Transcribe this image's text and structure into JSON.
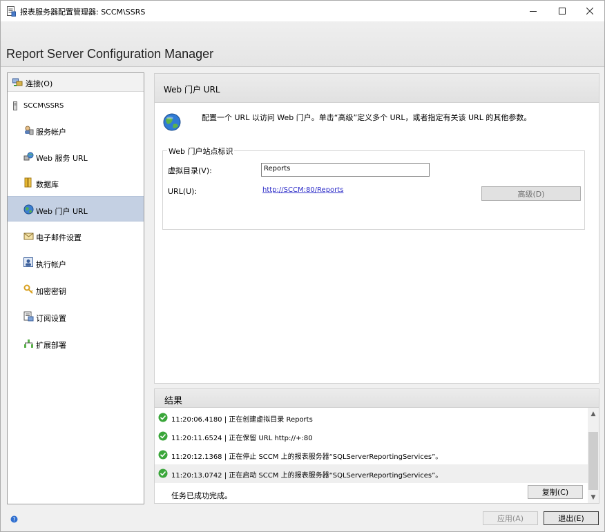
{
  "window": {
    "title": "报表服务器配置管理器: SCCM\\SSRS"
  },
  "banner": {
    "heading": "Report Server Configuration Manager"
  },
  "nav": {
    "connect_label": "连接(O)",
    "server_label": "SCCM\\SSRS",
    "items": [
      {
        "label": "服务帐户",
        "icon": "service-account-icon"
      },
      {
        "label": "Web 服务 URL",
        "icon": "web-service-icon"
      },
      {
        "label": "数据库",
        "icon": "database-icon"
      },
      {
        "label": "Web 门户 URL",
        "icon": "globe-icon"
      },
      {
        "label": "电子邮件设置",
        "icon": "email-icon"
      },
      {
        "label": "执行帐户",
        "icon": "execution-account-icon"
      },
      {
        "label": "加密密钥",
        "icon": "key-icon"
      },
      {
        "label": "订阅设置",
        "icon": "subscription-icon"
      },
      {
        "label": "扩展部署",
        "icon": "scale-out-icon"
      }
    ],
    "selected_index": 3
  },
  "panel": {
    "title": "Web 门户 URL",
    "description": "配置一个 URL 以访问 Web 门户。单击“高级”定义多个 URL，或者指定有关该 URL 的其他参数。",
    "group_label": "Web 门户站点标识",
    "vdir_label": "虚拟目录(V):",
    "vdir_value": "Reports",
    "url_label": "URL(U):",
    "url_value": "http://SCCM:80/Reports",
    "advanced_label": "高级(D)"
  },
  "results": {
    "title": "结果",
    "rows": [
      "11:20:06.4180 | 正在创建虚拟目录 Reports",
      "11:20:11.6524 | 正在保留 URL http://+:80",
      "11:20:12.1368 | 正在停止 SCCM 上的报表服务器“SQLServerReportingServices”。",
      "11:20:13.0742 | 正在启动 SCCM 上的报表服务器“SQLServerReportingServices”。"
    ],
    "done_text": "任务已成功完成。",
    "copy_label": "复制(C)"
  },
  "footer": {
    "apply_label": "应用(A)",
    "exit_label": "退出(E)"
  },
  "colors": {
    "selection": "#c4d0e3",
    "link": "#2c2cc8",
    "success": "#3aa63a"
  }
}
